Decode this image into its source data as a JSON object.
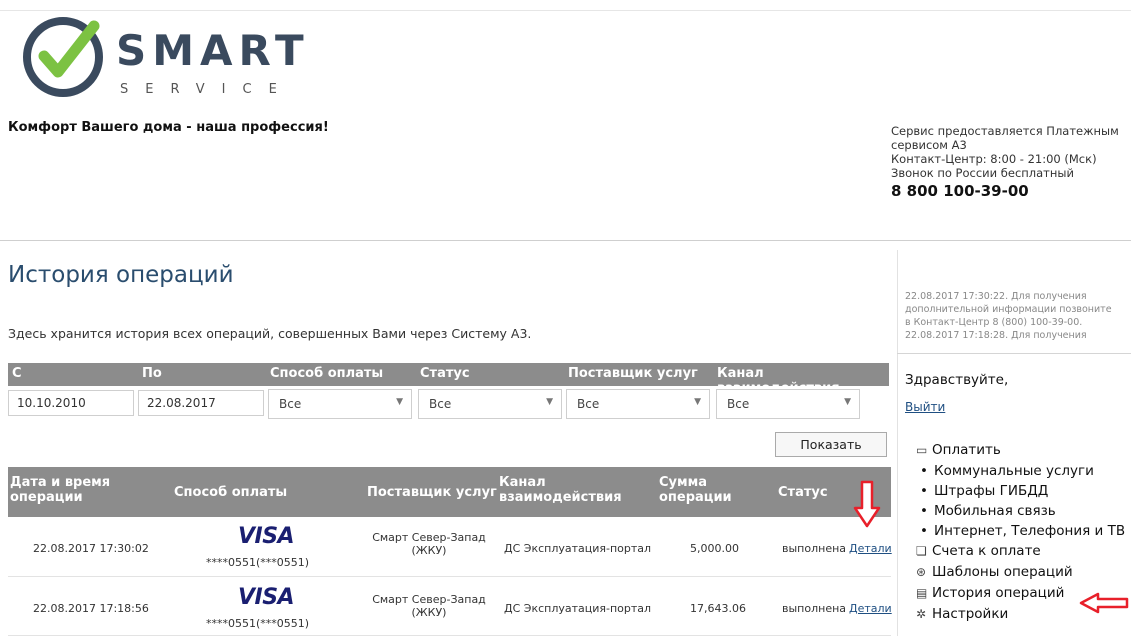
{
  "header": {
    "logo_main": "SMART",
    "logo_sub": "SERVICE",
    "tagline": "Комфорт Вашего дома - наша профессия!",
    "info_lines": [
      "Сервис предоставляется Платежным",
      "сервисом А3",
      "Контакт-Центр: 8:00 - 21:00 (Мск)",
      "Звонок по России бесплатный"
    ],
    "phone": "8 800 100-39-00"
  },
  "page": {
    "title": "История операций",
    "description": "Здесь хранится история всех операций, совершенных Вами через Систему А3."
  },
  "filters": {
    "headers": [
      "С",
      "По",
      "Способ оплаты",
      "Статус",
      "Поставщик услуг",
      "Канал взаимодействия"
    ],
    "date_from": "10.10.2010",
    "date_to": "22.08.2017",
    "payment_method": "Все",
    "status": "Все",
    "provider": "Все",
    "channel": "Все",
    "show_button": "Показать"
  },
  "table": {
    "headers": {
      "datetime_1": "Дата и время",
      "datetime_2": "операции",
      "method": "Способ оплаты",
      "provider": "Поставщик услуг",
      "channel_1": "Канал",
      "channel_2": "взаимодействия",
      "amount_1": "Сумма",
      "amount_2": "операции",
      "status": "Статус"
    },
    "rows": [
      {
        "datetime": "22.08.2017 17:30:02",
        "card_brand": "VISA",
        "card": "****0551(***0551)",
        "provider_1": "Смарт Север-Запад",
        "provider_2": "(ЖКУ)",
        "channel": "ДС Эксплуатация-портал",
        "amount": "5,000.00",
        "status": "выполнена",
        "details": "Детали"
      },
      {
        "datetime": "22.08.2017 17:18:56",
        "card_brand": "VISA",
        "card": "****0551(***0551)",
        "provider_1": "Смарт Север-Запад",
        "provider_2": "(ЖКУ)",
        "channel": "ДС Эксплуатация-портал",
        "amount": "17,643.06",
        "status": "выполнена",
        "details": "Детали"
      }
    ]
  },
  "sidebar": {
    "notice_lines": [
      "22.08.2017 17:30:22. Для получения",
      "дополнительной информации позвоните",
      "в Контакт-Центр 8 (800) 100-39-00.",
      "22.08.2017 17:18:28. Для получения"
    ],
    "greeting": "Здравствуйте,",
    "logout": "Выйти",
    "menu": {
      "pay": "Оплатить",
      "sub": [
        "Коммунальные услуги",
        "Штрафы ГИБДД",
        "Мобильная связь",
        "Интернет, Телефония и ТВ"
      ],
      "bills": "Счета к оплате",
      "templates": "Шаблоны операций",
      "history": "История операций",
      "settings": "Настройки"
    }
  },
  "colors": {
    "header_gray": "#8c8c8c",
    "title_blue": "#2a4d6e",
    "link_blue": "#1f4f82",
    "visa_blue": "#1a1f71",
    "annotation_red": "#e8202a",
    "logo_green": "#7cc242",
    "logo_dark": "#3a4a5e"
  }
}
